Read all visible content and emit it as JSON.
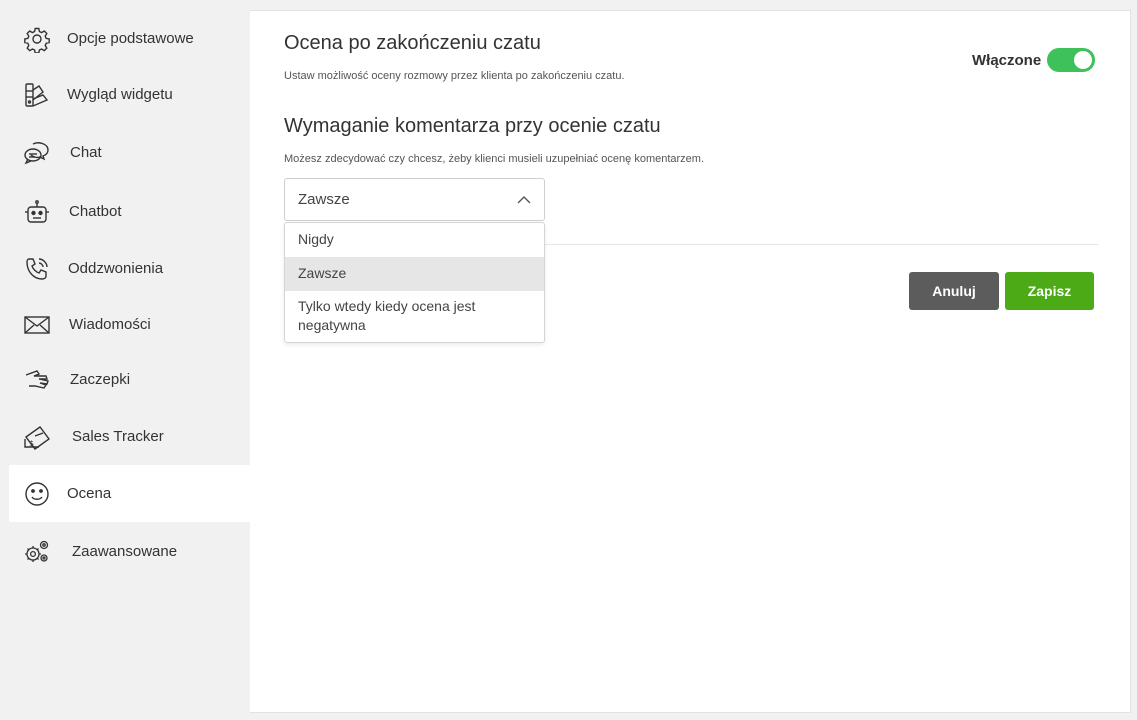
{
  "sidebar": {
    "items": [
      {
        "label": "Opcje podstawowe",
        "icon": "gear-icon"
      },
      {
        "label": "Wygląd widgetu",
        "icon": "palette-icon"
      },
      {
        "label": "Chat",
        "icon": "chat-bubbles-icon"
      },
      {
        "label": "Chatbot",
        "icon": "robot-icon"
      },
      {
        "label": "Oddzwonienia",
        "icon": "phone-icon"
      },
      {
        "label": "Wiadomości",
        "icon": "envelope-icon"
      },
      {
        "label": "Zaczepki",
        "icon": "hand-icon"
      },
      {
        "label": "Sales Tracker",
        "icon": "money-ticket-icon"
      },
      {
        "label": "Ocena",
        "icon": "smiley-icon",
        "active": true
      },
      {
        "label": "Zaawansowane",
        "icon": "gears-icon"
      }
    ]
  },
  "main": {
    "section1": {
      "title": "Ocena po zakończeniu czatu",
      "description": "Ustaw możliwość oceny rozmowy przez klienta po zakończeniu czatu.",
      "toggle_label": "Włączone",
      "toggle_on": true
    },
    "section2": {
      "title": "Wymaganie komentarza przy ocenie czatu",
      "description": "Możesz zdecydować czy chcesz, żeby klienci musieli uzupełniać ocenę komentarzem.",
      "select_value": "Zawsze",
      "options": [
        "Nigdy",
        "Zawsze",
        "Tylko wtedy kiedy ocena jest negatywna"
      ]
    },
    "buttons": {
      "cancel": "Anuluj",
      "save": "Zapisz"
    }
  },
  "colors": {
    "toggle_on": "#3ec15a",
    "save_button": "#4caa16",
    "cancel_button": "#5c5c5c",
    "sidebar_bg": "#f1f1f1"
  }
}
